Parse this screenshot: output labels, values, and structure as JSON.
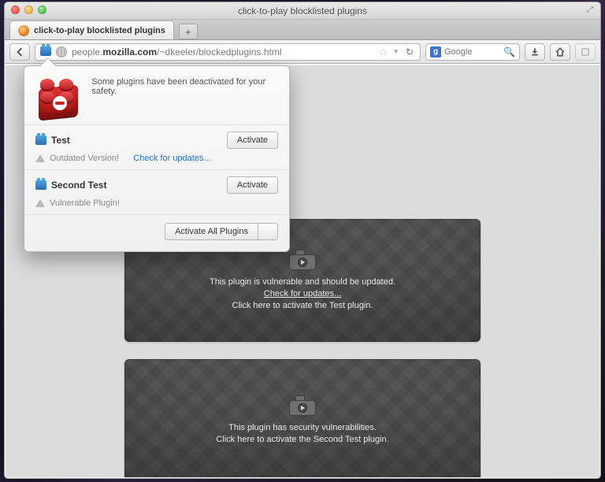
{
  "window": {
    "title": "click-to-play blocklisted plugins"
  },
  "tab": {
    "label": "click-to-play blocklisted plugins"
  },
  "url": {
    "prefix": "people.",
    "domain": "mozilla.com",
    "path": "/~dkeeler/blockedplugins.html"
  },
  "search": {
    "engine": "g",
    "placeholder": "Google"
  },
  "panel": {
    "message": "Some plugins have been deactivated for your safety.",
    "activate_label": "Activate",
    "activate_all_label": "Activate All Plugins",
    "items": [
      {
        "name": "Test",
        "warn": "Outdated Version!",
        "link": "Check for updates..."
      },
      {
        "name": "Second Test",
        "warn": "Vulnerable Plugin!",
        "link": ""
      }
    ]
  },
  "placeholders": [
    {
      "line1": "This plugin is vulnerable and should be updated.",
      "link": "Check for updates...",
      "line2": "Click here to activate the Test plugin."
    },
    {
      "line1": "This plugin has security vulnerabilities.",
      "link": "",
      "line2": "Click here to activate the Second Test plugin."
    }
  ]
}
